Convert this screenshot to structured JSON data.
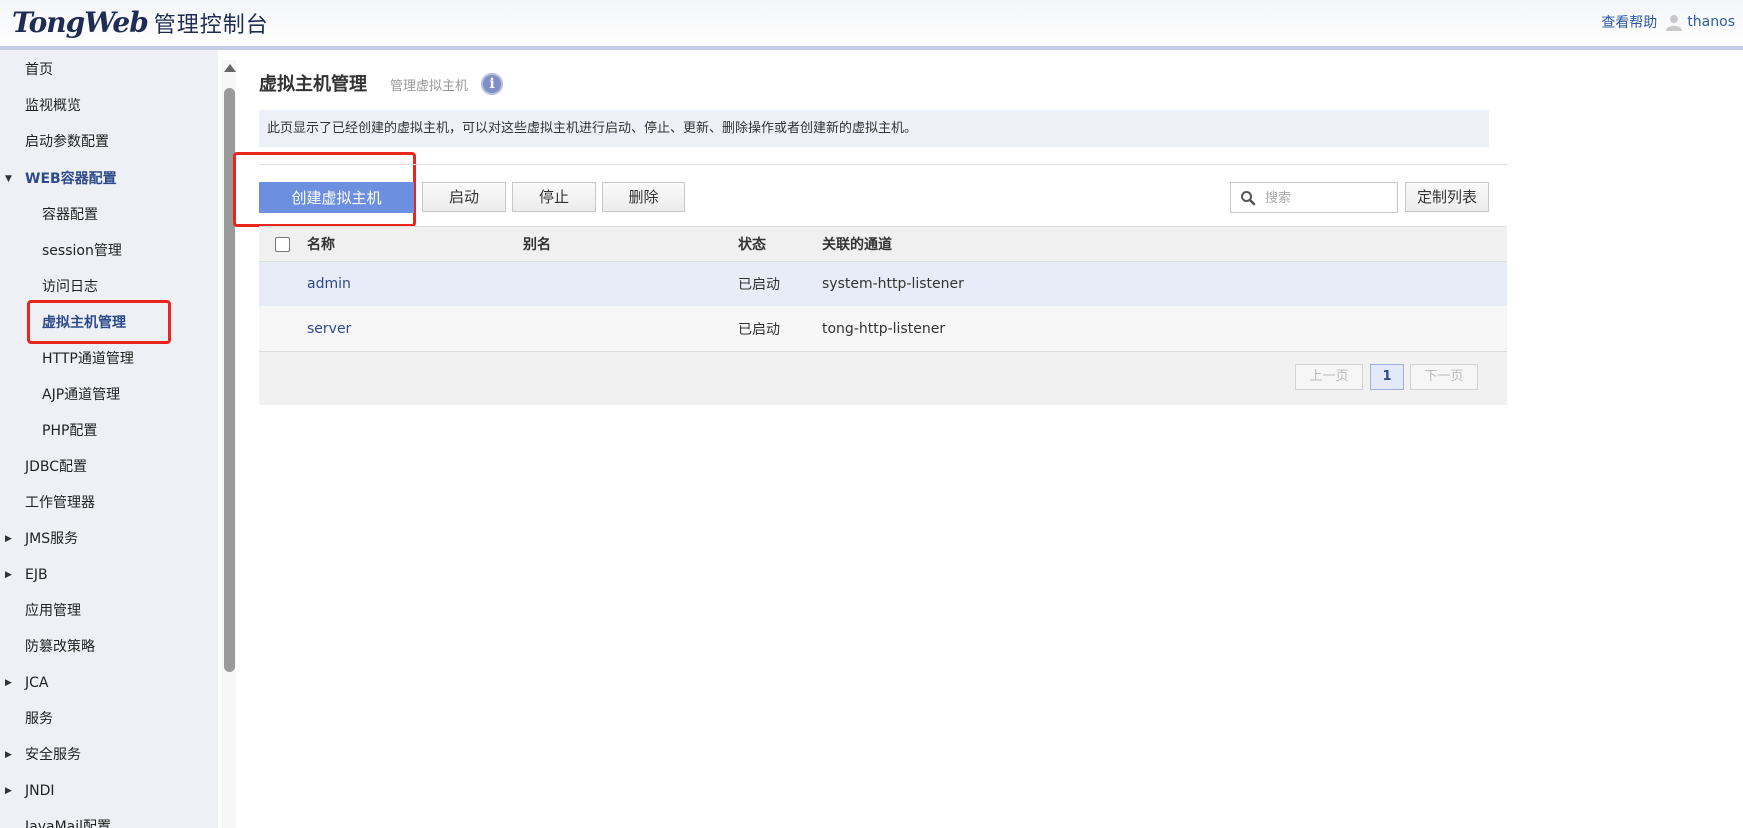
{
  "header": {
    "logo_brand": "TongWeb",
    "logo_sub": "管理控制台",
    "help": "查看帮助",
    "user": "thanos"
  },
  "sidebar": {
    "items": [
      {
        "label": "首页"
      },
      {
        "label": "监视概览"
      },
      {
        "label": "启动参数配置"
      },
      {
        "label": "WEB容器配置",
        "expanded": true
      },
      {
        "label": "容器配置"
      },
      {
        "label": "session管理"
      },
      {
        "label": "访问日志"
      },
      {
        "label": "虚拟主机管理",
        "selected": true
      },
      {
        "label": "HTTP通道管理"
      },
      {
        "label": "AJP通道管理"
      },
      {
        "label": "PHP配置"
      },
      {
        "label": "JDBC配置"
      },
      {
        "label": "工作管理器"
      },
      {
        "label": "JMS服务",
        "expandable": true
      },
      {
        "label": "EJB",
        "expandable": true
      },
      {
        "label": "应用管理"
      },
      {
        "label": "防篡改策略"
      },
      {
        "label": "JCA",
        "expandable": true
      },
      {
        "label": "服务"
      },
      {
        "label": "安全服务",
        "expandable": true
      },
      {
        "label": "JNDI",
        "expandable": true
      },
      {
        "label": "JavaMail配置"
      }
    ]
  },
  "main": {
    "title": "虚拟主机管理",
    "subtitle": "管理虚拟主机",
    "description": "此页显示了已经创建的虚拟主机，可以对这些虚拟主机进行启动、停止、更新、删除操作或者创建新的虚拟主机。",
    "toolbar": {
      "create": "创建虚拟主机",
      "start": "启动",
      "stop": "停止",
      "delete": "删除",
      "search_placeholder": "搜索",
      "customize": "定制列表"
    },
    "table": {
      "columns": [
        "名称",
        "别名",
        "状态",
        "关联的通道"
      ],
      "rows": [
        {
          "name": "admin",
          "alias": "",
          "status": "已启动",
          "channel": "system-http-listener"
        },
        {
          "name": "server",
          "alias": "",
          "status": "已启动",
          "channel": "tong-http-listener"
        }
      ]
    },
    "pager": {
      "prev": "上一页",
      "current": "1",
      "next": "下一页"
    }
  },
  "colors": {
    "primary": "#6d8fe0",
    "highlight": "#e8261e",
    "link": "#2d4a8a"
  }
}
